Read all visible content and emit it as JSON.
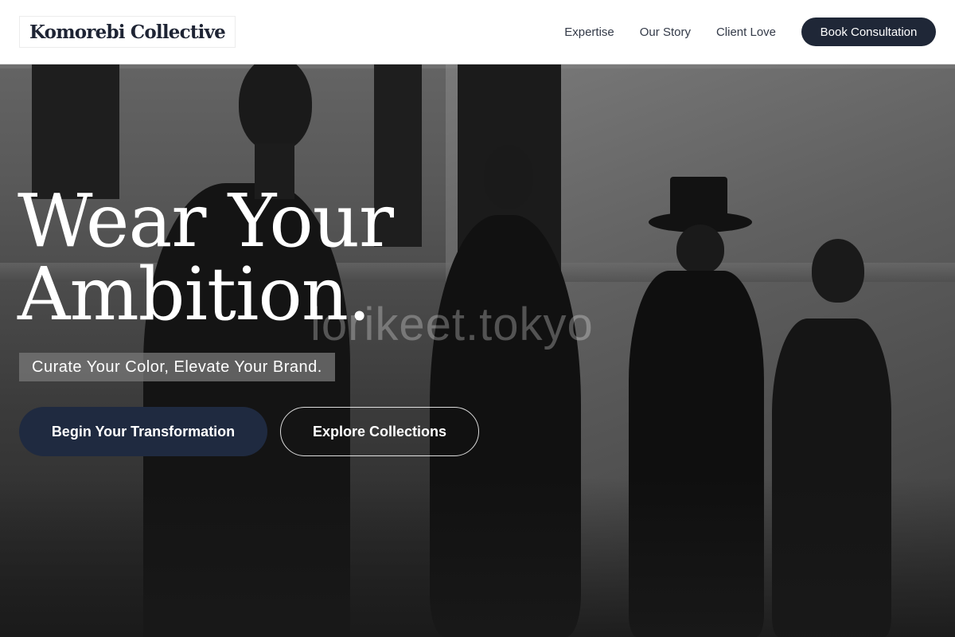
{
  "brand": {
    "name": "Komorebi Collective"
  },
  "nav": {
    "links": [
      "Expertise",
      "Our Story",
      "Client Love"
    ],
    "cta_label": "Book Consultation"
  },
  "hero": {
    "headline_line1": "Wear Your",
    "headline_line2": "Ambition.",
    "tagline": "Curate Your Color, Elevate Your Brand.",
    "primary_button": "Begin Your Transformation",
    "secondary_button": "Explore Collections",
    "watermark": "lorikeet.tokyo",
    "background_image": "black-and-white photo of dressed mannequins in a gallery"
  },
  "colors": {
    "navy_button": "#1f2a40",
    "nav_cta": "#1f2737",
    "brand_text": "#1e2434"
  }
}
